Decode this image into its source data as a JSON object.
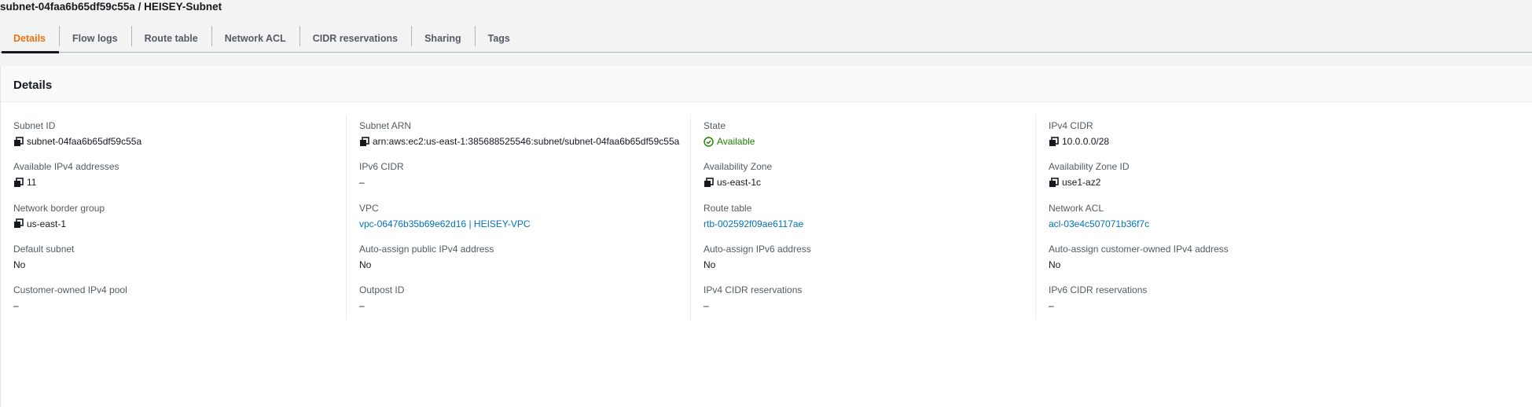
{
  "header": {
    "title": "subnet-04faa6b65df59c55a / HEISEY-Subnet"
  },
  "tabs": [
    "Details",
    "Flow logs",
    "Route table",
    "Network ACL",
    "CIDR reservations",
    "Sharing",
    "Tags"
  ],
  "active_tab": "Details",
  "panel": {
    "title": "Details"
  },
  "columns": [
    [
      {
        "label": "Subnet ID",
        "value": "subnet-04faa6b65df59c55a",
        "type": "copy"
      },
      {
        "label": "Available IPv4 addresses",
        "value": "11",
        "type": "copy"
      },
      {
        "label": "Network border group",
        "value": "us-east-1",
        "type": "copy"
      },
      {
        "label": "Default subnet",
        "value": "No",
        "type": "text"
      },
      {
        "label": "Customer-owned IPv4 pool",
        "value": "–",
        "type": "text"
      }
    ],
    [
      {
        "label": "Subnet ARN",
        "value": "arn:aws:ec2:us-east-1:385688525546:subnet/subnet-04faa6b65df59c55a",
        "type": "copy"
      },
      {
        "label": "IPv6 CIDR",
        "value": "–",
        "type": "text"
      },
      {
        "label": "VPC",
        "value": "vpc-06476b35b69e62d16 | HEISEY-VPC",
        "type": "link"
      },
      {
        "label": "Auto-assign public IPv4 address",
        "value": "No",
        "type": "text"
      },
      {
        "label": "Outpost ID",
        "value": "–",
        "type": "text"
      }
    ],
    [
      {
        "label": "State",
        "value": "Available",
        "type": "status"
      },
      {
        "label": "Availability Zone",
        "value": "us-east-1c",
        "type": "copy"
      },
      {
        "label": "Route table",
        "value": "rtb-002592f09ae6117ae",
        "type": "link"
      },
      {
        "label": "Auto-assign IPv6 address",
        "value": "No",
        "type": "text"
      },
      {
        "label": "IPv4 CIDR reservations",
        "value": "–",
        "type": "text"
      }
    ],
    [
      {
        "label": "IPv4 CIDR",
        "value": "10.0.0.0/28",
        "type": "copy"
      },
      {
        "label": "Availability Zone ID",
        "value": "use1-az2",
        "type": "copy"
      },
      {
        "label": "Network ACL",
        "value": "acl-03e4c507071b36f7c",
        "type": "link"
      },
      {
        "label": "Auto-assign customer-owned IPv4 address",
        "value": "No",
        "type": "text"
      },
      {
        "label": "IPv6 CIDR reservations",
        "value": "–",
        "type": "text"
      }
    ]
  ],
  "colors": {
    "accent": "#ec7211",
    "link": "#0073bb",
    "success": "#1d8102"
  }
}
